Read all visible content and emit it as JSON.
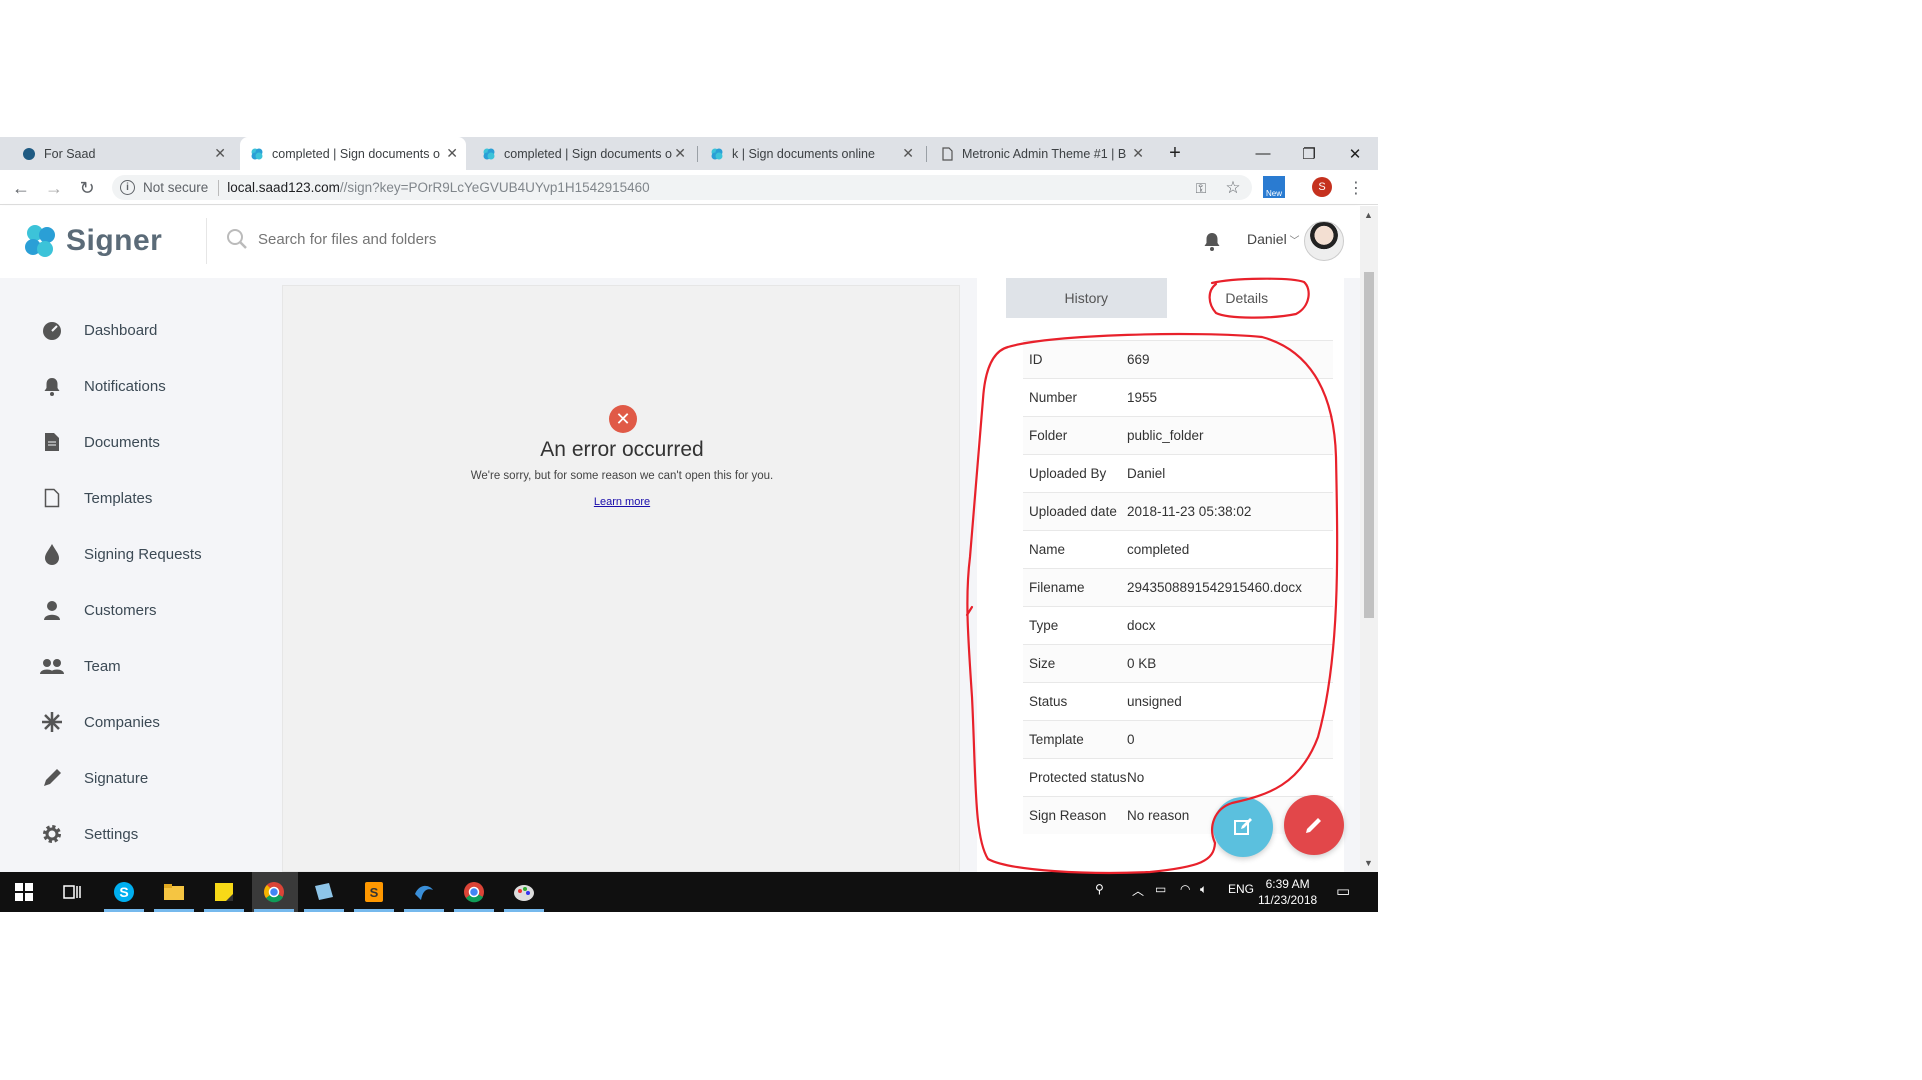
{
  "browser": {
    "tabs": [
      {
        "title": "For   Saad",
        "active": false
      },
      {
        "title": "completed | Sign documents o",
        "active": true
      },
      {
        "title": "completed | Sign documents o",
        "active": false
      },
      {
        "title": "k | Sign documents online",
        "active": false
      },
      {
        "title": "Metronic Admin Theme #1 | B",
        "active": false
      }
    ],
    "new_tab_label": "+",
    "security_label": "Not secure",
    "url_host": "local.saad123.com",
    "url_path": "//sign?key=POrR9LcYeGVUB4UYvp1H1542915460",
    "profile_initial": "S",
    "ext_badge": "New"
  },
  "app": {
    "logo_text": "Signer",
    "search_placeholder": "Search for files and folders",
    "user_name": "Daniel"
  },
  "sidebar": {
    "items": [
      {
        "label": "Dashboard",
        "icon": "dashboard-icon"
      },
      {
        "label": "Notifications",
        "icon": "bell-icon"
      },
      {
        "label": "Documents",
        "icon": "document-icon"
      },
      {
        "label": "Templates",
        "icon": "template-icon"
      },
      {
        "label": "Signing Requests",
        "icon": "drop-icon"
      },
      {
        "label": "Customers",
        "icon": "customer-icon"
      },
      {
        "label": "Team",
        "icon": "team-icon"
      },
      {
        "label": "Companies",
        "icon": "companies-icon"
      },
      {
        "label": "Signature",
        "icon": "pen-icon"
      },
      {
        "label": "Settings",
        "icon": "gear-icon"
      }
    ]
  },
  "viewer": {
    "error_title": "An error occurred",
    "error_message": "We're sorry, but for some reason we can't open this for you.",
    "learn_more": "Learn more"
  },
  "panel": {
    "tab_history": "History",
    "tab_details": "Details",
    "details": [
      {
        "key": "ID",
        "value": "669"
      },
      {
        "key": "Number",
        "value": "1955"
      },
      {
        "key": "Folder",
        "value": "public_folder"
      },
      {
        "key": "Uploaded By",
        "value": "Daniel"
      },
      {
        "key": "Uploaded date",
        "value": "2018-11-23 05:38:02"
      },
      {
        "key": "Name",
        "value": "completed"
      },
      {
        "key": "Filename",
        "value": "2943508891542915460.docx"
      },
      {
        "key": "Type",
        "value": "docx"
      },
      {
        "key": "Size",
        "value": "0 KB"
      },
      {
        "key": "Status",
        "value": "unsigned"
      },
      {
        "key": "Template",
        "value": "0"
      },
      {
        "key": "Protected status",
        "value": "No"
      },
      {
        "key": "Sign Reason",
        "value": "No reason"
      }
    ]
  },
  "taskbar": {
    "lang": "ENG",
    "time": "6:39 AM",
    "date": "11/23/2018"
  },
  "colors": {
    "accent_teal": "#3cc3d9",
    "fab_blue": "#5bc0de",
    "fab_red": "#e2474a",
    "annotation_red": "#e8212b"
  }
}
